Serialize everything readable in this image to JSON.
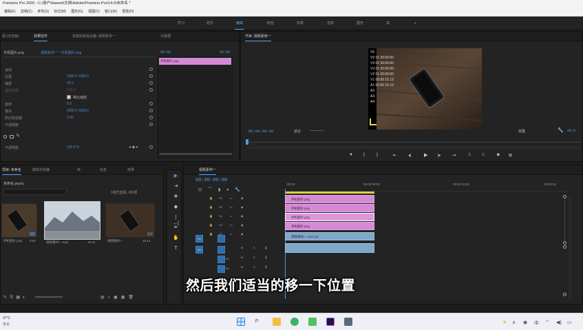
{
  "window": {
    "title": "Premiere Pro 2020 - C:\\用户\\Haseel\\文档\\Adobe\\Premiere Pro\\14.0\\未命名 *"
  },
  "menu": [
    "编辑(E)",
    "剪辑(C)",
    "序列(S)",
    "标记(M)",
    "图形(G)",
    "视图(V)",
    "窗口(W)",
    "帮助(H)"
  ],
  "workspaces": [
    "学习",
    "组件",
    "编辑",
    "颜色",
    "效果",
    "音频",
    "图形",
    "库",
    "»"
  ],
  "effect_controls": {
    "tabs": [
      "源:(无剪辑)",
      "效果控件",
      "音频剪辑混合器: 视频素材一",
      "元数据"
    ],
    "source_clip": "手机图片.png",
    "sequence_clip": "视频素材一 * 手机图片.png",
    "timecode_start": "00:00",
    "timecode_end": "00:00",
    "rows": [
      {
        "label": "运动",
        "value": ""
      },
      {
        "label": "位置",
        "value": "1920.0   1080.0"
      },
      {
        "label": "缩放",
        "value": "35.0"
      },
      {
        "label": "缩放宽度",
        "value": "100.0"
      },
      {
        "label": "",
        "value": "等比缩放"
      },
      {
        "label": "旋转",
        "value": "0.0"
      },
      {
        "label": "锚点",
        "value": "2500.0   1659.0"
      },
      {
        "label": "防闪烁滤镜",
        "value": "0.00"
      },
      {
        "label": "不透明度",
        "value": ""
      }
    ],
    "opacity_row": {
      "label": "不透明度",
      "value": "100.0 %"
    },
    "mini_clip": "手机图片.png"
  },
  "program_monitor": {
    "tabs": [
      "节目: 视频素材一"
    ],
    "timecode": "00:00:00:00",
    "fit_label": "适合",
    "quality_label": "完整",
    "track_overlay": [
      "V6",
      "V5 01 00:00:00",
      "V4 01 00:00:00",
      "V3 01 00:00:00",
      "V2 01 00:00:00",
      "V1 00:00 15 13",
      "A1 00:00 15 13",
      "A2",
      "A3",
      "A4"
    ]
  },
  "project": {
    "tabs": [
      "项目: 未命名",
      "媒体浏览器",
      "库",
      "信息",
      "效果"
    ],
    "search_value": "未命名.prproj",
    "selection_info": "1项已选择, 共5项",
    "items": [
      {
        "name": "手机图片.png",
        "duration": "5:00"
      },
      {
        "name": "视频素材一.mp4",
        "duration": "15:13"
      },
      {
        "name": "视频素材一",
        "duration": "15:13"
      }
    ]
  },
  "timeline": {
    "tab": "视频素材一",
    "timecode": "00:00:00:00",
    "ruler": [
      ":00:00",
      "00:00:05:00",
      "00:00:10:00",
      "00:00:15:"
    ],
    "video_tracks": [
      "V6",
      "V5",
      "V4",
      "V3",
      "V2",
      "V1"
    ],
    "audio_tracks": [
      "A1",
      "A2",
      "A3"
    ],
    "clips": [
      {
        "name": "手机图片.png",
        "track": "V5"
      },
      {
        "name": "手机图片.png",
        "track": "V4"
      },
      {
        "name": "手机图片.png",
        "track": "V3"
      },
      {
        "name": "手机图片.png",
        "track": "V2"
      },
      {
        "name": "视频素材一.mp4 [V]",
        "track": "V1"
      },
      {
        "name": "",
        "track": "A1"
      }
    ]
  },
  "subtitle": "然后我们适当的移一下位置",
  "taskbar": {
    "weather_temp": "37°C",
    "weather_desc": "多云"
  },
  "colors": {
    "accent": "#4da6ff",
    "clip_pink": "#d48ad4",
    "clip_blue": "#7fa7c9",
    "timecode_blue": "#4a9ee8",
    "panel_bg": "#232323"
  }
}
